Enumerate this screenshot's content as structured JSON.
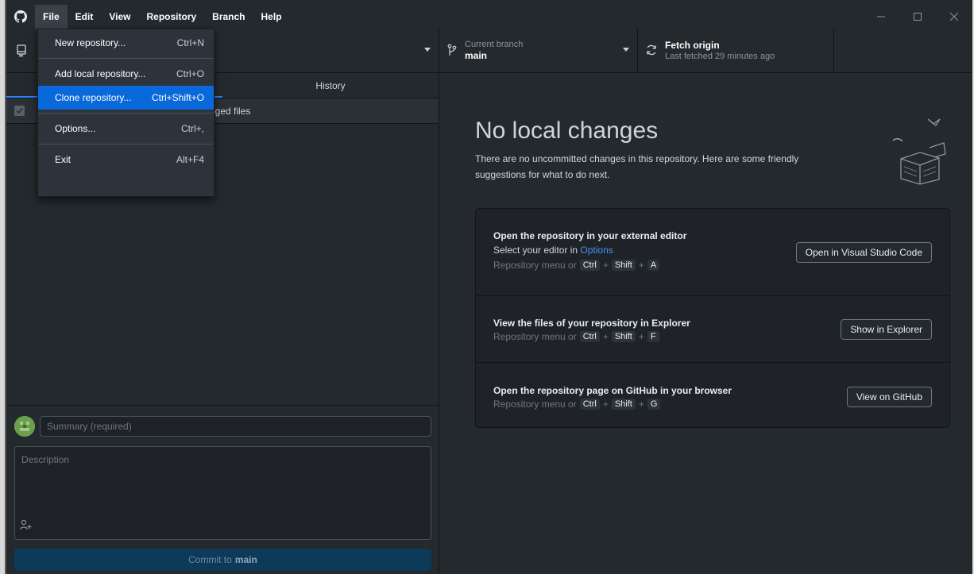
{
  "menubar": {
    "items": [
      "File",
      "Edit",
      "View",
      "Repository",
      "Branch",
      "Help"
    ]
  },
  "file_menu": {
    "items": [
      {
        "label": "New repository...",
        "shortcut": "Ctrl+N"
      },
      {
        "label": "Add local repository...",
        "shortcut": "Ctrl+O"
      },
      {
        "label": "Clone repository...",
        "shortcut": "Ctrl+Shift+O"
      },
      {
        "label": "Options...",
        "shortcut": "Ctrl+,"
      },
      {
        "label": "Exit",
        "shortcut": "Alt+F4"
      }
    ]
  },
  "toolbar": {
    "branch_label": "Current branch",
    "branch_name": "main",
    "fetch_label": "Fetch origin",
    "fetch_sub": "Last fetched 29 minutes ago"
  },
  "sidebar": {
    "tab_history": "History",
    "changed_files_partial": "nged files",
    "summary_placeholder": "Summary (required)",
    "description_placeholder": "Description",
    "commit_prefix": "Commit to",
    "commit_branch": "main"
  },
  "main": {
    "title": "No local changes",
    "description": "There are no uncommitted changes in this repository. Here are some friendly suggestions for what to do next.",
    "suggestions": [
      {
        "title": "Open the repository in your external editor",
        "line_prefix": "Select your editor in",
        "line_link": "Options",
        "hint_prefix": "Repository menu or",
        "keys": [
          "Ctrl",
          "Shift",
          "A"
        ],
        "button": "Open in Visual Studio Code"
      },
      {
        "title": "View the files of your repository in Explorer",
        "hint_prefix": "Repository menu or",
        "keys": [
          "Ctrl",
          "Shift",
          "F"
        ],
        "button": "Show in Explorer"
      },
      {
        "title": "Open the repository page on GitHub in your browser",
        "hint_prefix": "Repository menu or",
        "keys": [
          "Ctrl",
          "Shift",
          "G"
        ],
        "button": "View on GitHub"
      }
    ]
  },
  "colors": {
    "background": "#24292e",
    "highlight": "#0969da",
    "link": "#4493f8",
    "commit_button": "#0e3a5a"
  },
  "icons": {
    "app": "github-logo-icon",
    "repo": "repo-icon",
    "branch": "git-branch-icon",
    "fetch": "sync-icon",
    "coauthor": "person-add-icon"
  }
}
